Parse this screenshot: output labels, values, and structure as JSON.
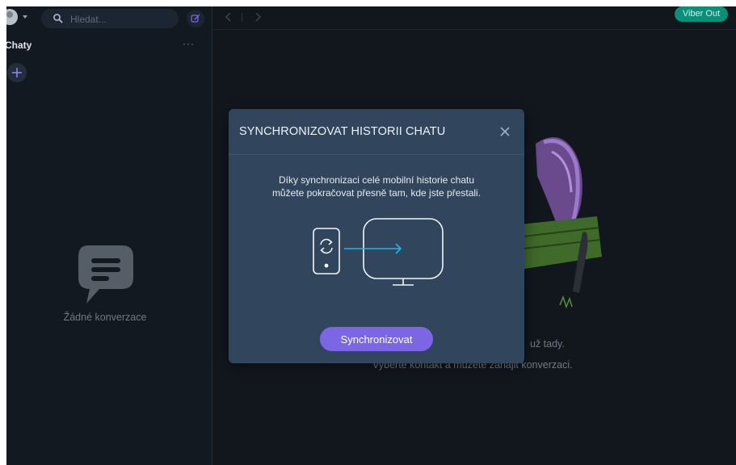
{
  "search": {
    "placeholder": "Hledat..."
  },
  "sidebar": {
    "chats_title": "Chaty",
    "more_label": "···",
    "empty_text": "Žádné konverzace"
  },
  "topbar": {
    "viber_out": "Viber Out"
  },
  "main": {
    "welcome_line1": "už tady.",
    "welcome_line2": "Vyberte kontakt a můžete zahájit konverzaci."
  },
  "dialog": {
    "title": "SYNCHRONIZOVAT HISTORII CHATU",
    "desc_line1": "Díky synchronizaci celé mobilní historie chatu",
    "desc_line2": "můžete pokračovat přesně tam, kde jste přestali.",
    "sync_button": "Synchronizovat"
  },
  "colors": {
    "accent": "#7d66e3",
    "viber_out": "#0c8f79",
    "sync_arrow": "#1fb7e6"
  },
  "icons": [
    "search-icon",
    "compose-icon",
    "plus-icon",
    "chat-bubble-icon",
    "chevron-left-icon",
    "chevron-right-icon",
    "close-icon",
    "sync-icon",
    "phone-icon",
    "monitor-icon"
  ]
}
